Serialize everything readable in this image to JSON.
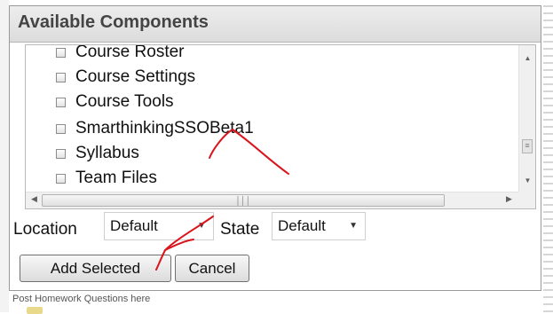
{
  "dialog": {
    "title": "Available Components",
    "items": [
      {
        "label": "Course Roster",
        "checked": false
      },
      {
        "label": "Course Settings",
        "checked": false
      },
      {
        "label": "Course Tools",
        "checked": false
      },
      {
        "label": "SmarthinkingSSOBeta1",
        "checked": false
      },
      {
        "label": "Syllabus",
        "checked": false
      },
      {
        "label": "Team Files",
        "checked": false
      }
    ],
    "location_label": "Location",
    "location_value": "Default",
    "state_label": "State",
    "state_value": "Default",
    "add_selected_label": "Add Selected",
    "cancel_label": "Cancel"
  },
  "background": {
    "footer_text": "Post Homework Questions here"
  },
  "annotation_color": "#d9141b"
}
